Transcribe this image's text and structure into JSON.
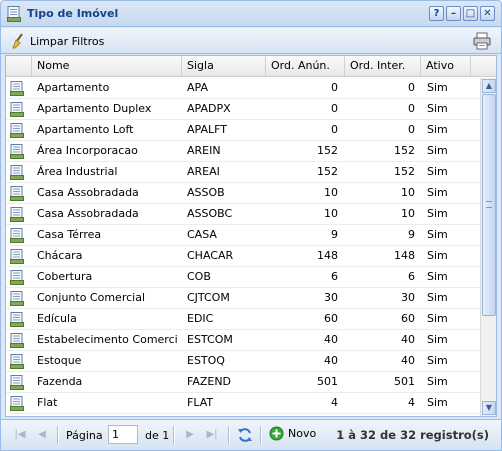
{
  "window": {
    "title": "Tipo de Imóvel",
    "controls": [
      "?",
      "–",
      "□",
      "✕"
    ]
  },
  "toolbar": {
    "clear_filters_label": "Limpar Filtros"
  },
  "grid": {
    "columns": [
      "Nome",
      "Sigla",
      "Ord. Anún.",
      "Ord. Inter.",
      "Ativo"
    ],
    "rows": [
      {
        "nome": "Apartamento",
        "sigla": "APA",
        "ord_anun": "0",
        "ord_inter": "0",
        "ativo": "Sim"
      },
      {
        "nome": "Apartamento Duplex",
        "sigla": "APADPX",
        "ord_anun": "0",
        "ord_inter": "0",
        "ativo": "Sim"
      },
      {
        "nome": "Apartamento Loft",
        "sigla": "APALFT",
        "ord_anun": "0",
        "ord_inter": "0",
        "ativo": "Sim"
      },
      {
        "nome": "Área Incorporacao",
        "sigla": "AREIN",
        "ord_anun": "152",
        "ord_inter": "152",
        "ativo": "Sim"
      },
      {
        "nome": "Área Industrial",
        "sigla": "AREAI",
        "ord_anun": "152",
        "ord_inter": "152",
        "ativo": "Sim"
      },
      {
        "nome": "Casa Assobradada",
        "sigla": "ASSOB",
        "ord_anun": "10",
        "ord_inter": "10",
        "ativo": "Sim"
      },
      {
        "nome": "Casa Assobradada",
        "sigla": "ASSOBC",
        "ord_anun": "10",
        "ord_inter": "10",
        "ativo": "Sim"
      },
      {
        "nome": "Casa Térrea",
        "sigla": "CASA",
        "ord_anun": "9",
        "ord_inter": "9",
        "ativo": "Sim"
      },
      {
        "nome": "Chácara",
        "sigla": "CHACAR",
        "ord_anun": "148",
        "ord_inter": "148",
        "ativo": "Sim"
      },
      {
        "nome": "Cobertura",
        "sigla": "COB",
        "ord_anun": "6",
        "ord_inter": "6",
        "ativo": "Sim"
      },
      {
        "nome": "Conjunto Comercial",
        "sigla": "CJTCOM",
        "ord_anun": "30",
        "ord_inter": "30",
        "ativo": "Sim"
      },
      {
        "nome": "Edícula",
        "sigla": "EDIC",
        "ord_anun": "60",
        "ord_inter": "60",
        "ativo": "Sim"
      },
      {
        "nome": "Estabelecimento Comercial",
        "sigla": "ESTCOM",
        "ord_anun": "40",
        "ord_inter": "40",
        "ativo": "Sim"
      },
      {
        "nome": "Estoque",
        "sigla": "ESTOQ",
        "ord_anun": "40",
        "ord_inter": "40",
        "ativo": "Sim"
      },
      {
        "nome": "Fazenda",
        "sigla": "FAZEND",
        "ord_anun": "501",
        "ord_inter": "501",
        "ativo": "Sim"
      },
      {
        "nome": "Flat",
        "sigla": "FLAT",
        "ord_anun": "4",
        "ord_inter": "4",
        "ativo": "Sim"
      }
    ]
  },
  "pager": {
    "page_label": "Página",
    "page_value": "1",
    "of_label": "de 1",
    "new_label": "Novo",
    "count_label": "1 à 32 de 32 registro(s)"
  },
  "icons": {
    "title": "form-icon",
    "clear": "broom-icon",
    "print": "printer-icon",
    "row": "edit-record-icon",
    "refresh": "refresh-icon",
    "new": "add-icon"
  },
  "colors": {
    "header_text": "#15428b",
    "border": "#99bbe8",
    "panel_bg": "#dfe8f6",
    "add_green": "#3aa53a"
  }
}
